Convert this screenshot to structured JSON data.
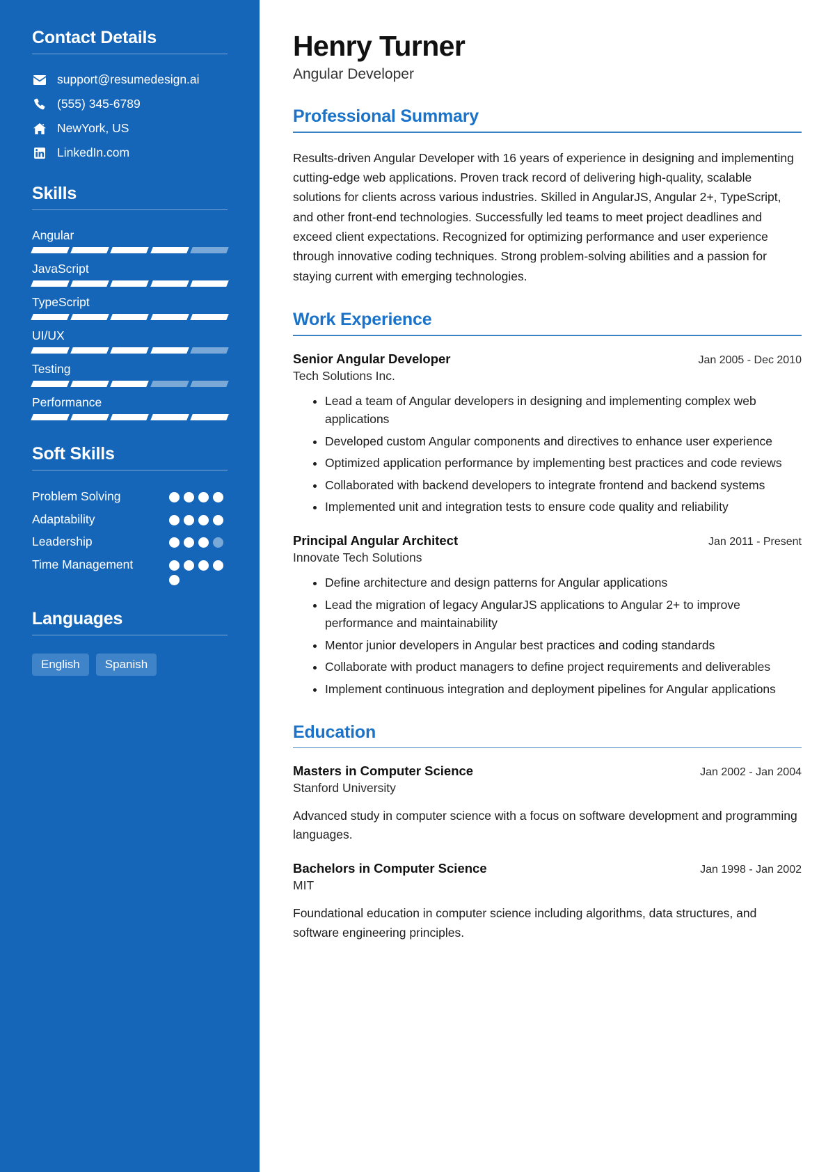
{
  "theme": {
    "sidebar_bg": "#1565b8",
    "accent": "#1a73c8",
    "chip_bg": "#3f83c8",
    "bar_on": "#ffffff",
    "bar_off": "#7aa9d8"
  },
  "sidebar": {
    "contact": {
      "heading": "Contact Details",
      "items": [
        {
          "icon": "envelope-icon",
          "text": "support@resumedesign.ai"
        },
        {
          "icon": "phone-icon",
          "text": "(555) 345-6789"
        },
        {
          "icon": "home-icon",
          "text": "NewYork, US"
        },
        {
          "icon": "linkedin-icon",
          "text": "LinkedIn.com"
        }
      ]
    },
    "skills": {
      "heading": "Skills",
      "segments_total": 5,
      "items": [
        {
          "name": "Angular",
          "filled": 4
        },
        {
          "name": "JavaScript",
          "filled": 5
        },
        {
          "name": "TypeScript",
          "filled": 5
        },
        {
          "name": "UI/UX",
          "filled": 4
        },
        {
          "name": "Testing",
          "filled": 3
        },
        {
          "name": "Performance",
          "filled": 5
        }
      ]
    },
    "soft_skills": {
      "heading": "Soft Skills",
      "dots_total": 4,
      "items": [
        {
          "name": "Problem Solving",
          "filled": 4,
          "dots": 4
        },
        {
          "name": "Adaptability",
          "filled": 4,
          "dots": 4
        },
        {
          "name": "Leadership",
          "filled": 3,
          "dots": 4
        },
        {
          "name": "Time Management",
          "filled": 5,
          "dots": 5
        }
      ]
    },
    "languages": {
      "heading": "Languages",
      "items": [
        "English",
        "Spanish"
      ]
    }
  },
  "main": {
    "name": "Henry Turner",
    "job_title": "Angular Developer",
    "summary": {
      "heading": "Professional Summary",
      "text": "Results-driven Angular Developer with 16 years of experience in designing and implementing cutting-edge web applications. Proven track record of delivering high-quality, scalable solutions for clients across various industries. Skilled in AngularJS, Angular 2+, TypeScript, and other front-end technologies. Successfully led teams to meet project deadlines and exceed client expectations. Recognized for optimizing performance and user experience through innovative coding techniques. Strong problem-solving abilities and a passion for staying current with emerging technologies."
    },
    "work": {
      "heading": "Work Experience",
      "entries": [
        {
          "title": "Senior Angular Developer",
          "date": "Jan 2005 - Dec 2010",
          "org": "Tech Solutions Inc.",
          "bullets": [
            "Lead a team of Angular developers in designing and implementing complex web applications",
            "Developed custom Angular components and directives to enhance user experience",
            "Optimized application performance by implementing best practices and code reviews",
            "Collaborated with backend developers to integrate frontend and backend systems",
            "Implemented unit and integration tests to ensure code quality and reliability"
          ]
        },
        {
          "title": "Principal Angular Architect",
          "date": "Jan 2011 - Present",
          "org": "Innovate Tech Solutions",
          "bullets": [
            "Define architecture and design patterns for Angular applications",
            "Lead the migration of legacy AngularJS applications to Angular 2+ to improve performance and maintainability",
            "Mentor junior developers in Angular best practices and coding standards",
            "Collaborate with product managers to define project requirements and deliverables",
            "Implement continuous integration and deployment pipelines for Angular applications"
          ]
        }
      ]
    },
    "education": {
      "heading": "Education",
      "entries": [
        {
          "title": "Masters in Computer Science",
          "date": "Jan 2002 - Jan 2004",
          "org": "Stanford University",
          "desc": "Advanced study in computer science with a focus on software development and programming languages."
        },
        {
          "title": "Bachelors in Computer Science",
          "date": "Jan 1998 - Jan 2002",
          "org": "MIT",
          "desc": "Foundational education in computer science including algorithms, data structures, and software engineering principles."
        }
      ]
    }
  }
}
